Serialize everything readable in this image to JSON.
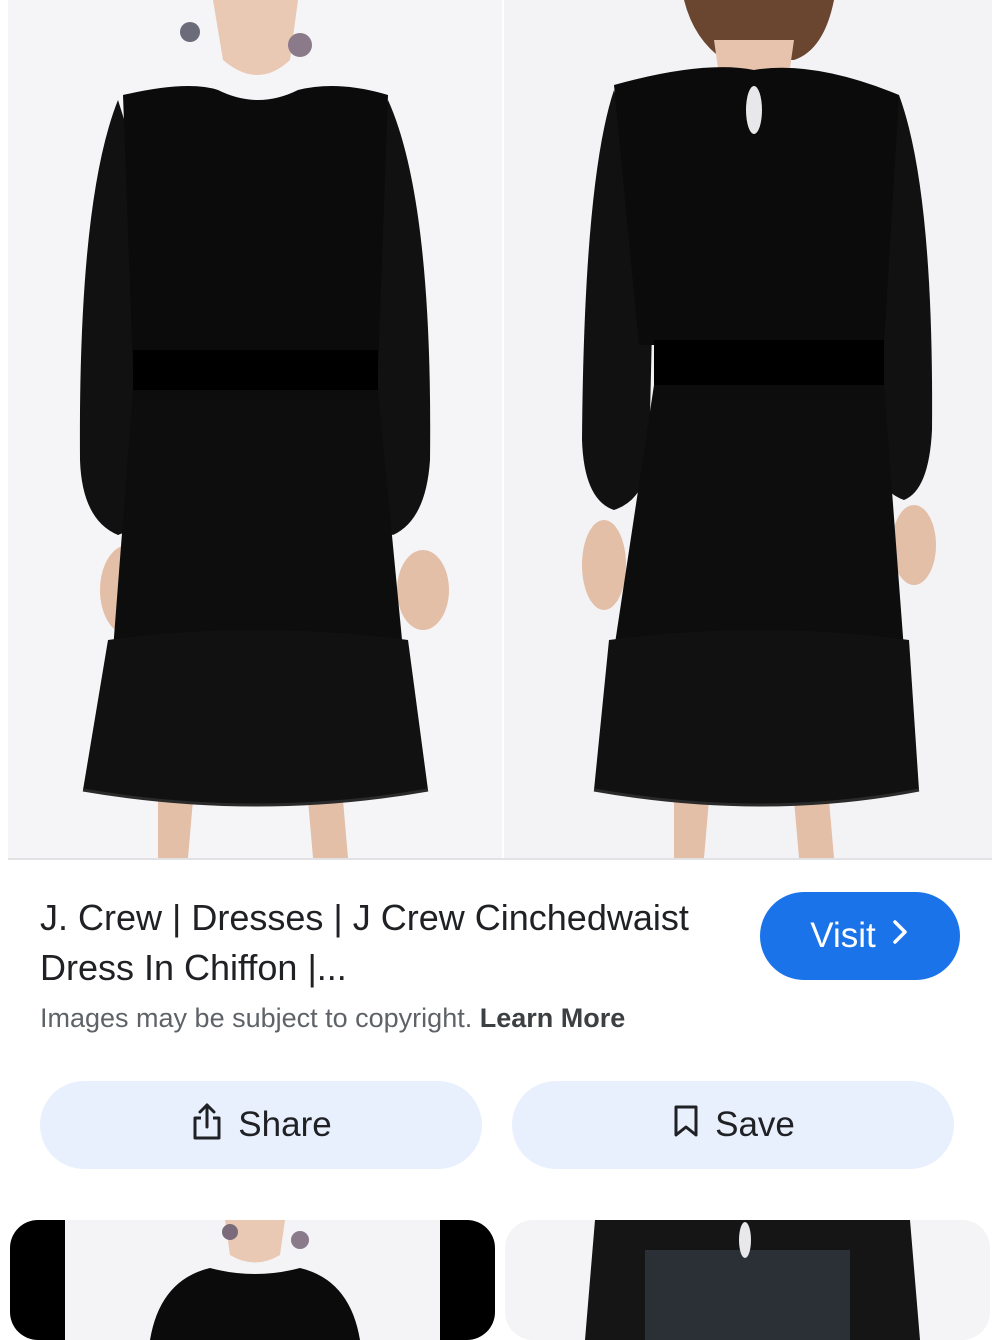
{
  "result": {
    "title": "J. Crew | Dresses | J Crew Cinchedwaist Dress In Chiffon |...",
    "copyright_text": "Images may be subject to copyright.",
    "learn_more": "Learn More",
    "visit_label": "Visit",
    "share_label": "Share",
    "save_label": "Save"
  },
  "colors": {
    "accent": "#1a73e8",
    "button_bg": "#e8f0fe",
    "dress": "#0b0b0b"
  },
  "icons": [
    "chevron-right-icon",
    "share-icon",
    "bookmark-icon"
  ]
}
